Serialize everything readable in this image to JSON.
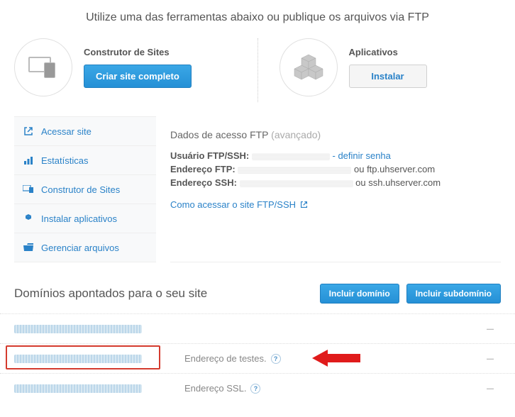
{
  "header": {
    "subtitle": "Utilize uma das ferramentas abaixo ou publique os arquivos via FTP"
  },
  "tools": {
    "builder": {
      "title": "Construtor de Sites",
      "button": "Criar site completo"
    },
    "apps": {
      "title": "Aplicativos",
      "button": "Instalar"
    }
  },
  "sidebar": {
    "items": [
      {
        "label": "Acessar site"
      },
      {
        "label": "Estatísticas"
      },
      {
        "label": "Construtor de Sites"
      },
      {
        "label": "Instalar aplicativos"
      },
      {
        "label": "Gerenciar arquivos"
      }
    ]
  },
  "ftp": {
    "title": "Dados de acesso FTP",
    "advanced": "(avançado)",
    "user_label": "Usuário FTP/SSH:",
    "define_password": "- definir senha",
    "ftp_addr_label": "Endereço FTP:",
    "ftp_addr_suffix": "ou ftp.uhserver.com",
    "ssh_addr_label": "Endereço SSH:",
    "ssh_addr_suffix": "ou ssh.uhserver.com",
    "access_link": "Como acessar o site FTP/SSH"
  },
  "domains": {
    "title": "Domínios apontados para o seu site",
    "include_domain": "Incluir domínio",
    "include_subdomain": "Incluir subdomínio",
    "rows": [
      {
        "label": ""
      },
      {
        "label": "Endereço de testes."
      },
      {
        "label": "Endereço SSL."
      }
    ]
  }
}
